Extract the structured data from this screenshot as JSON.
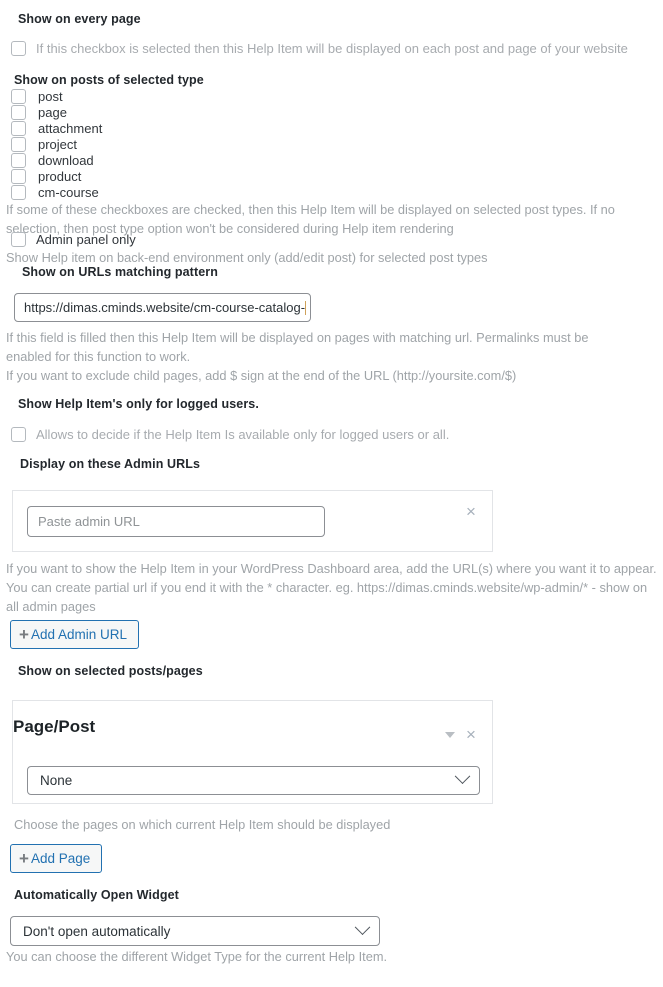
{
  "sections": {
    "every_page": {
      "heading": "Show on every page",
      "checkbox_label": "If this checkbox is selected then this Help Item will be displayed on each post and page of your website"
    },
    "post_types": {
      "heading": "Show on posts of selected type",
      "items": [
        {
          "label": "post",
          "checked": false
        },
        {
          "label": "page",
          "checked": false
        },
        {
          "label": "attachment",
          "checked": false
        },
        {
          "label": "project",
          "checked": false
        },
        {
          "label": "download",
          "checked": false
        },
        {
          "label": "product",
          "checked": false
        },
        {
          "label": "cm-course",
          "checked": false
        }
      ],
      "help": "If some of these checkboxes are checked, then this Help Item will be displayed on selected post types. If no selection, then post type option won't be considered during Help item rendering",
      "admin_only_label": "Admin panel only",
      "admin_only_help": "Show Help item on back-end environment only (add/edit post) for selected post types"
    },
    "url_pattern": {
      "heading": "Show on URLs matching pattern",
      "value": "https://dimas.cminds.website/cm-course-catalog-",
      "help_line1": "If this field is filled then this Help Item will be displayed on pages with matching url. Permalinks must be enabled for this function to work.",
      "help_line2": "If you want to exclude child pages, add $ sign at the end of the URL (http://yoursite.com/$)"
    },
    "logged_users": {
      "heading": "Show Help Item's only for logged users.",
      "checkbox_label": "Allows to decide if the Help Item Is available only for logged users or all."
    },
    "admin_urls": {
      "heading": "Display on these Admin URLs",
      "input_placeholder": "Paste admin URL",
      "input_value": "",
      "remove_icon": "×",
      "help": "If you want to show the Help Item in your WordPress Dashboard area, add the URL(s) where you want it to appear. You can create partial url if you end it with the * character. eg. https://dimas.cminds.website/wp-admin/* - show on all admin pages",
      "add_button": "Add Admin URL",
      "plus": "+"
    },
    "selected_posts": {
      "heading": "Show on selected posts/pages",
      "panel_title": "Page/Post",
      "select_value": "None",
      "remove_icon": "×",
      "help": "Choose the pages on which current Help Item should be displayed",
      "add_button": "Add Page",
      "plus": "+"
    },
    "auto_open": {
      "heading": "Automatically Open Widget",
      "select_value": "Don't open automatically",
      "help": "You can choose the different Widget Type for the current Help Item."
    }
  },
  "colors": {
    "accent_blue": "#2271b1",
    "muted_text": "#9fa4a8",
    "border_gray": "#8c8f94",
    "panel_border": "#e2e4e7"
  }
}
